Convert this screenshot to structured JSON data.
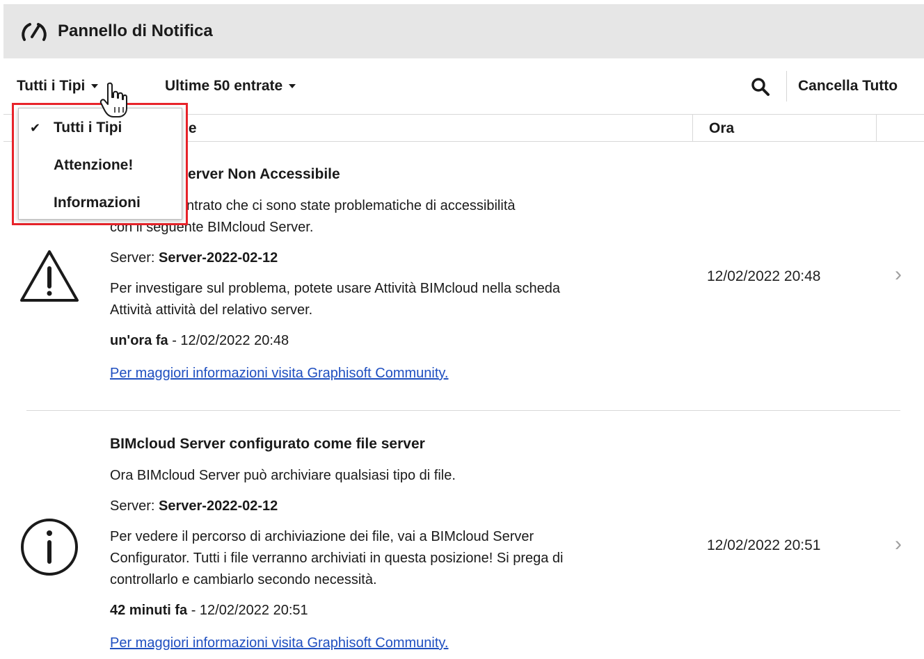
{
  "header": {
    "title": "Pannello di Notifica",
    "icon": "gauge-icon"
  },
  "toolbar": {
    "type_filter": "Tutti i Tipi",
    "entries_filter": "Ultime 50 entrate",
    "clear_all": "Cancella Tutto",
    "search_icon": "search-icon"
  },
  "table": {
    "col_description_visible": "ne",
    "col_time": "Ora"
  },
  "dropdown": {
    "items": [
      {
        "label": "Tutti i Tipi",
        "checked": true
      },
      {
        "label": "Attenzione!",
        "checked": false
      },
      {
        "label": "Informazioni",
        "checked": false
      }
    ]
  },
  "notifications": [
    {
      "icon": "warning-icon",
      "title": "Server Non Accessibile",
      "line1": "ha riscontrato che ci sono state problematiche di accessibilità",
      "line2": "con il seguente BIMcloud Server.",
      "server_label": "Server: ",
      "server_name": "Server-2022-02-12",
      "detail1": "Per investigare sul problema, potete usare Attività BIMcloud nella scheda",
      "detail2": "Attività attività del relativo server.",
      "ago": "un'ora fa",
      "stamp": " - 12/02/2022 20:48",
      "link": "Per maggiori informazioni visita Graphisoft Community.",
      "time": "12/02/2022 20:48"
    },
    {
      "icon": "info-icon",
      "title": "BIMcloud Server configurato come file server",
      "line1": "Ora BIMcloud Server può archiviare qualsiasi tipo di file.",
      "server_label": "Server: ",
      "server_name": "Server-2022-02-12",
      "detail1": "Per vedere il percorso di archiviazione dei file, vai a BIMcloud Server",
      "detail2": "Configurator. Tutti i file verranno archiviati in questa posizione! Si prega di",
      "detail3": "controllarlo e cambiarlo secondo necessità.",
      "ago": "42 minuti fa",
      "stamp": " - 12/02/2022 20:51",
      "link": "Per maggiori informazioni visita Graphisoft Community.",
      "time": "12/02/2022 20:51"
    }
  ],
  "colors": {
    "header_bg": "#e6e6e6",
    "highlight": "#e8232a",
    "link": "#1f4fc0"
  }
}
